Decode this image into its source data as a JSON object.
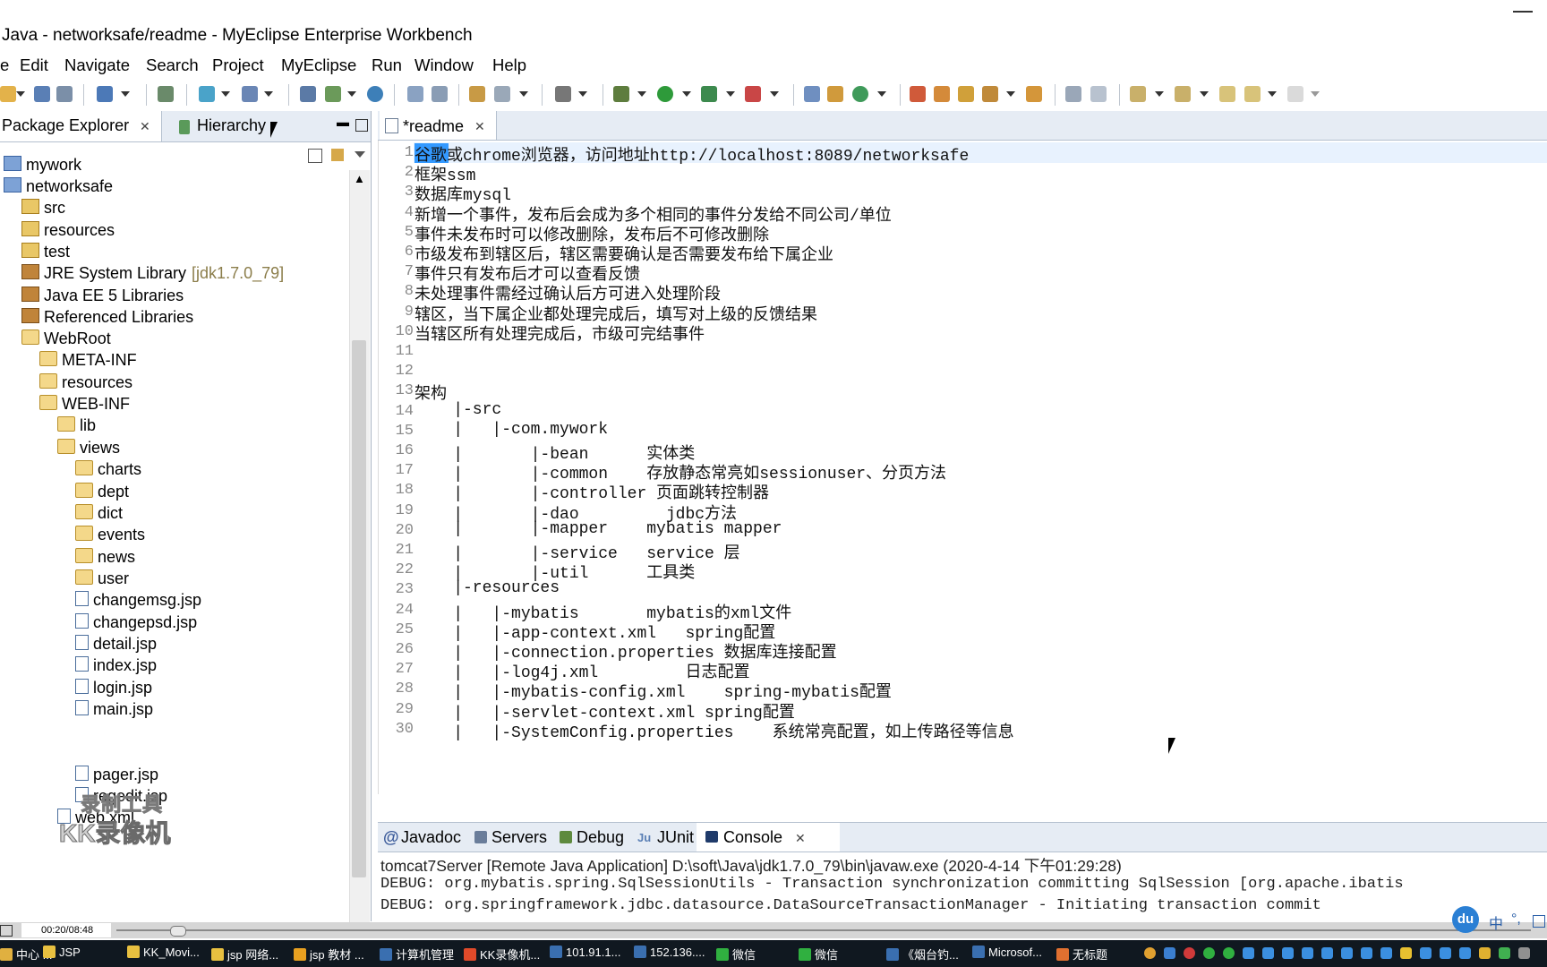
{
  "window": {
    "title": "Java - networksafe/readme - MyEclipse Enterprise Workbench"
  },
  "menu": [
    "e",
    "Edit",
    "Navigate",
    "Search",
    "Project",
    "MyEclipse",
    "Run",
    "Window",
    "Help"
  ],
  "left_panel": {
    "tabs": [
      "Package Explorer",
      "Hierarchy"
    ],
    "tree": [
      {
        "label": "mywork",
        "icon": "project-icon"
      },
      {
        "label": "networksafe",
        "icon": "project-icon"
      },
      {
        "label": "src",
        "icon": "source-folder-icon"
      },
      {
        "label": "resources",
        "icon": "source-folder-icon"
      },
      {
        "label": "test",
        "icon": "source-folder-icon"
      },
      {
        "label": "JRE System Library",
        "extra": "[jdk1.7.0_79]",
        "icon": "library-icon"
      },
      {
        "label": "Java EE 5 Libraries",
        "icon": "library-icon"
      },
      {
        "label": "Referenced Libraries",
        "icon": "library-icon"
      },
      {
        "label": "WebRoot",
        "icon": "folder-icon"
      },
      {
        "label": "META-INF",
        "icon": "folder-icon"
      },
      {
        "label": "resources",
        "icon": "folder-icon"
      },
      {
        "label": "WEB-INF",
        "icon": "folder-icon"
      },
      {
        "label": "lib",
        "icon": "folder-icon"
      },
      {
        "label": "views",
        "icon": "folder-icon"
      },
      {
        "label": "charts",
        "icon": "folder-icon"
      },
      {
        "label": "dept",
        "icon": "folder-icon"
      },
      {
        "label": "dict",
        "icon": "folder-icon"
      },
      {
        "label": "events",
        "icon": "folder-icon"
      },
      {
        "label": "news",
        "icon": "folder-icon"
      },
      {
        "label": "user",
        "icon": "folder-icon"
      },
      {
        "label": "changemsg.jsp",
        "icon": "jsp-file-icon"
      },
      {
        "label": "changepsd.jsp",
        "icon": "jsp-file-icon"
      },
      {
        "label": "detail.jsp",
        "icon": "jsp-file-icon"
      },
      {
        "label": "index.jsp",
        "icon": "jsp-file-icon"
      },
      {
        "label": "login.jsp",
        "icon": "jsp-file-icon"
      },
      {
        "label": "main.jsp",
        "icon": "jsp-file-icon"
      },
      {
        "label": "pager.jsp",
        "icon": "jsp-file-icon"
      },
      {
        "label": "regedit.jsp",
        "icon": "jsp-file-icon"
      },
      {
        "label": "web.xml",
        "icon": "xml-file-icon"
      }
    ]
  },
  "editor": {
    "tab": "*readme",
    "lines": [
      {
        "n": "1",
        "text": "谷歌或chrome浏览器，访问地址http://localhost:8089/networksafe"
      },
      {
        "n": "2",
        "text": "框架ssm"
      },
      {
        "n": "3",
        "text": "数据库mysql"
      },
      {
        "n": "4",
        "text": "新增一个事件，发布后会成为多个相同的事件分发给不同公司/单位"
      },
      {
        "n": "5",
        "text": "事件未发布时可以修改删除，发布后不可修改删除"
      },
      {
        "n": "6",
        "text": "市级发布到辖区后，辖区需要确认是否需要发布给下属企业"
      },
      {
        "n": "7",
        "text": "事件只有发布后才可以查看反馈"
      },
      {
        "n": "8",
        "text": "未处理事件需经过确认后方可进入处理阶段"
      },
      {
        "n": "9",
        "text": "辖区，当下属企业都处理完成后，填写对上级的反馈结果"
      },
      {
        "n": "10",
        "text": "当辖区所有处理完成后，市级可完结事件"
      },
      {
        "n": "11",
        "text": ""
      },
      {
        "n": "12",
        "text": ""
      },
      {
        "n": "13",
        "text": "架构"
      },
      {
        "n": "14",
        "text": "    |-src"
      },
      {
        "n": "15",
        "text": "    |   |-com.mywork"
      },
      {
        "n": "16",
        "text": "    |       |-bean      实体类"
      },
      {
        "n": "17",
        "text": "    |       |-common    存放静态常亮如sessionuser、分页方法"
      },
      {
        "n": "18",
        "text": "    |       |-controller 页面跳转控制器"
      },
      {
        "n": "19",
        "text": "    |       |-dao         jdbc方法"
      },
      {
        "n": "20",
        "text": "    |       |-mapper    mybatis mapper"
      },
      {
        "n": "21",
        "text": "    |       |-service   service 层"
      },
      {
        "n": "22",
        "text": "    |       |-util      工具类"
      },
      {
        "n": "23",
        "text": "    |-resources"
      },
      {
        "n": "24",
        "text": "    |   |-mybatis       mybatis的xml文件"
      },
      {
        "n": "25",
        "text": "    |   |-app-context.xml   spring配置"
      },
      {
        "n": "26",
        "text": "    |   |-connection.properties 数据库连接配置"
      },
      {
        "n": "27",
        "text": "    |   |-log4j.xml         日志配置"
      },
      {
        "n": "28",
        "text": "    |   |-mybatis-config.xml    spring-mybatis配置"
      },
      {
        "n": "29",
        "text": "    |   |-servlet-context.xml spring配置"
      },
      {
        "n": "30",
        "text": "    |   |-SystemConfig.properties    系统常亮配置，如上传路径等信息"
      }
    ]
  },
  "bottom_panel": {
    "tabs": [
      "Javadoc",
      "Servers",
      "Debug",
      "JUnit",
      "Console"
    ],
    "header": "tomcat7Server [Remote Java Application] D:\\soft\\Java\\jdk1.7.0_79\\bin\\javaw.exe (2020-4-14 下午01:29:28)",
    "lines": [
      "DEBUG: org.mybatis.spring.SqlSessionUtils - Transaction synchronization committing SqlSession [org.apache.ibatis",
      "DEBUG: org.springframework.jdbc.datasource.DataSourceTransactionManager - Initiating transaction commit"
    ]
  },
  "recorder": {
    "time": "00:20/08:48",
    "watermark_top": "录制工具",
    "watermark_bottom": "KK录像机"
  },
  "taskbar": {
    "items": [
      "中心 ...",
      "JSP",
      "KK_Movi...",
      "jsp 网络...",
      "jsp 教材 ...",
      "计算机管理",
      "KK录像机...",
      "101.91.1...",
      "152.136....",
      "微信",
      "微信",
      "《烟台钓...",
      "Microsof...",
      "无标题"
    ],
    "ime": "中"
  }
}
